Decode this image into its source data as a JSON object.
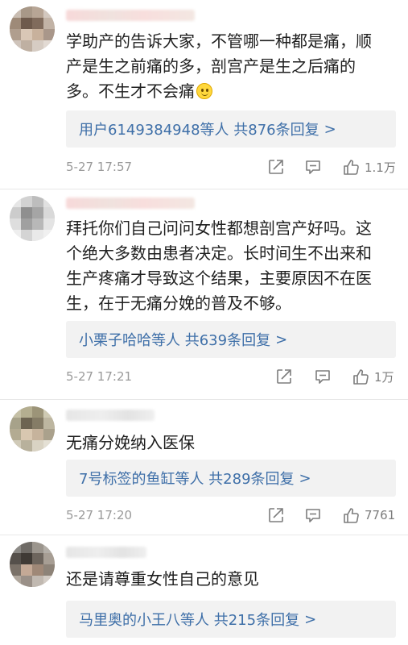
{
  "comments": [
    {
      "text": "学助产的告诉大家，不管哪一种都是痛，顺\n产是生之前痛的多，剖宫产是生之后痛的\n多。不生才不会痛",
      "emoji": "slightly-smiling-face",
      "reply_summary": "用户6149384948等人  共876条回复",
      "reply_chevron": ">",
      "timestamp": "5-27 17:57",
      "likes": "1.1万"
    },
    {
      "text": "拜托你们自己问问女性都想剖宫产好吗。这\n个绝大多数由患者决定。长时间生不出来和\n生产疼痛才导致这个结果，主要原因不在医\n生，在于无痛分娩的普及不够。",
      "reply_summary": "小栗子哈哈等人  共639条回复",
      "reply_chevron": ">",
      "timestamp": "5-27 17:21",
      "likes": "1万"
    },
    {
      "text": "无痛分娩纳入医保",
      "reply_summary": "7号标签的鱼缸等人  共289条回复",
      "reply_chevron": ">",
      "timestamp": "5-27 17:20",
      "likes": "7761"
    },
    {
      "text": "还是请尊重女性自己的意见",
      "reply_summary": "马里奥的小王八等人  共215条回复",
      "reply_chevron": ">"
    }
  ],
  "icons": {
    "share": "share-icon",
    "comment": "comment-icon",
    "like": "thumbs-up-icon"
  },
  "colors": {
    "link_blue": "#3e6fa8",
    "meta_grey": "#9a9a9a",
    "reply_bg": "#f2f2f2"
  }
}
